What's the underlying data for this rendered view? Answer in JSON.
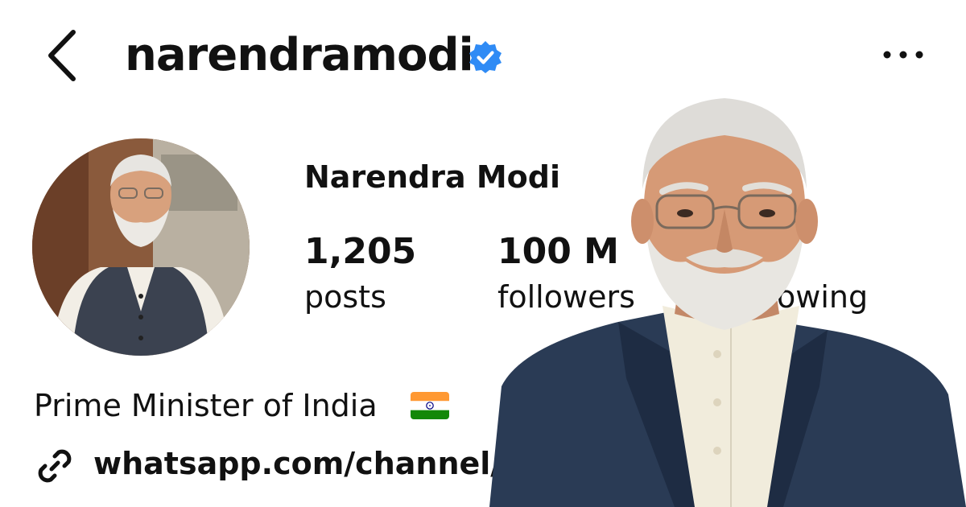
{
  "header": {
    "username": "narendramodi",
    "verified": true,
    "back_icon": "chevron-left-icon",
    "more_icon": "more-horizontal-icon"
  },
  "profile": {
    "display_name": "Narendra Modi",
    "stats": [
      {
        "value": "1,205",
        "label": "posts"
      },
      {
        "value": "100 M",
        "label": "followers"
      },
      {
        "value": "",
        "label": "owing"
      }
    ],
    "bio": "Prime Minister of India",
    "bio_flag_icon": "india-flag-icon",
    "link": "whatsapp.com/channel/",
    "link_icon": "link-icon"
  },
  "colors": {
    "verified_blue": "#2f8bf5",
    "text": "#111111",
    "background": "#ffffff"
  }
}
